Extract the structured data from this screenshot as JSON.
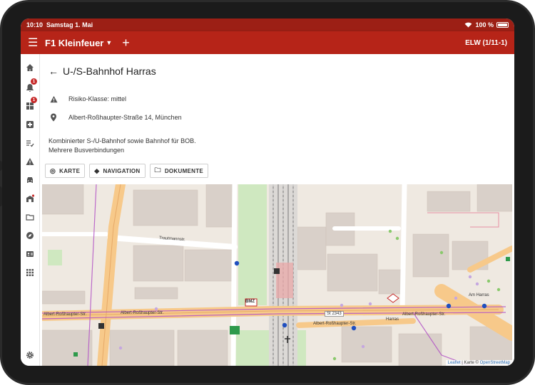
{
  "status_bar": {
    "time": "10:10",
    "date": "Samstag 1. Mai",
    "battery": "100 %"
  },
  "app_bar": {
    "title": "F1 Kleinfeuer",
    "unit": "ELW (1/11-1)"
  },
  "rail": {
    "badges": [
      "1",
      "1"
    ]
  },
  "page": {
    "title": "U-/S-Bahnhof Harras",
    "risk": "Risiko-Klasse: mittel",
    "address": "Albert-Roßhaupter-Straße 14, München",
    "description_line1": "Kombinierter S-/U-Bahnhof sowie Bahnhof für BOB.",
    "description_line2": "Mehrere Busverbindungen"
  },
  "buttons": {
    "map": "KARTE",
    "navigation": "NAVIGATION",
    "documents": "DOKUMENTE"
  },
  "map": {
    "streets": {
      "trautmann": "Trautmannstr.",
      "albert_left": "Albert-Roßhaupter-Str.",
      "albert_mid": "Albert-Roßhaupter-Str.",
      "albert_low": "Albert-Roßhaupter-Str.",
      "albert_right": "Albert-Roßhaupter-Str.",
      "harras": "Harras",
      "am_harras": "Am Harras",
      "st2343": "St 2343",
      "bmz": "BMZ"
    },
    "attribution": {
      "leaflet": "Leaflet",
      "sep": " | Karte © ",
      "osm": "OpenStreetMap"
    }
  }
}
